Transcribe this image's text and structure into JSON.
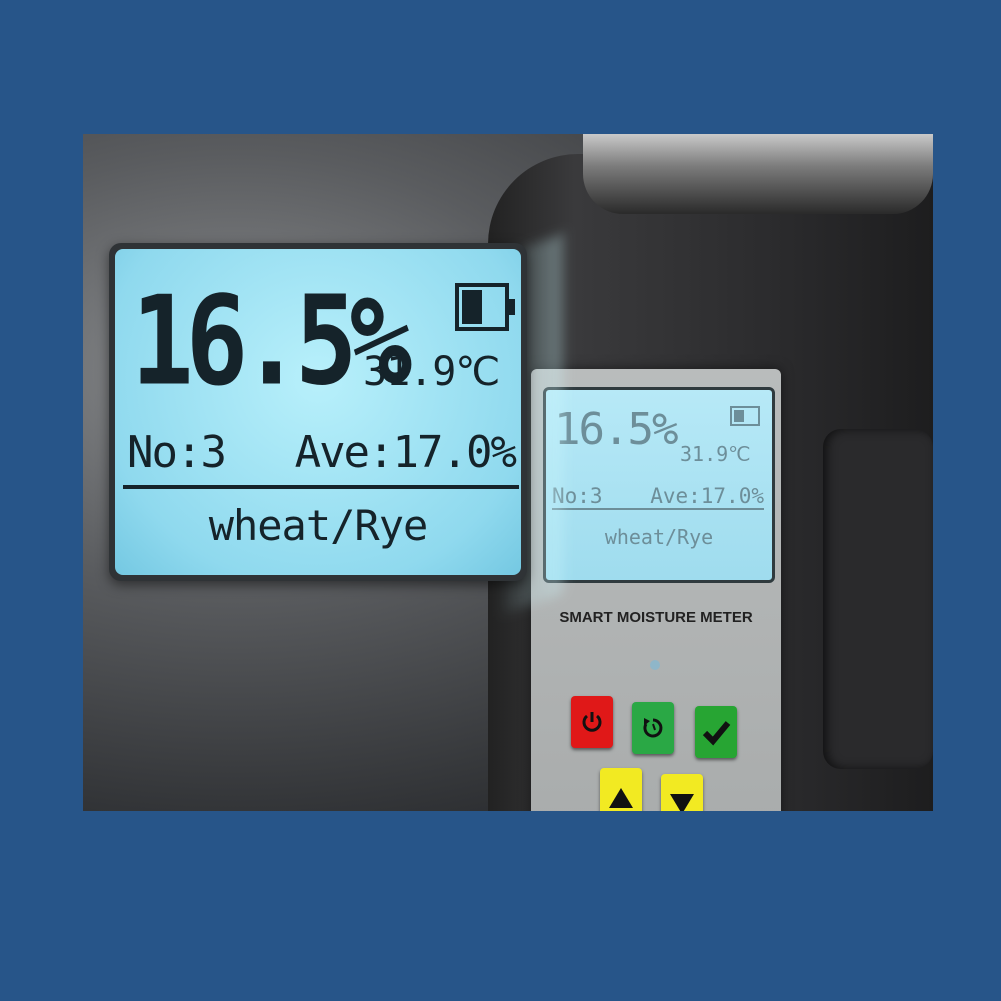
{
  "large_display": {
    "moisture": "16.5%",
    "temperature": "31.9℃",
    "count": "No:3",
    "average": "Ave:17.0%",
    "grain": "wheat/Rye"
  },
  "small_display": {
    "moisture": "16.5%",
    "temperature": "31.9℃",
    "count": "No:3",
    "average": "Ave:17.0%",
    "grain": "wheat/Rye"
  },
  "device": {
    "label": "SMART MOISTURE METER"
  },
  "buttons": {
    "power": "power-icon",
    "reset": "reset-icon",
    "confirm": "check-icon",
    "up": "up-arrow-icon",
    "down": "down-arrow-icon"
  },
  "colors": {
    "background": "#275589",
    "lcd": "#9fdcee",
    "power": "#e01818",
    "green": "#27a533",
    "yellow": "#f2ea22"
  }
}
